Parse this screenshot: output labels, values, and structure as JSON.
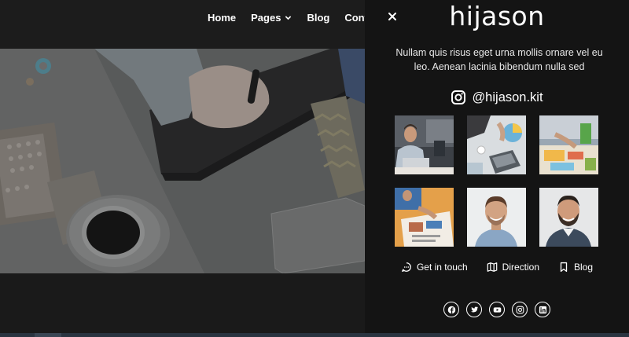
{
  "nav": {
    "items": [
      {
        "label": "Home"
      },
      {
        "label": "Pages",
        "has_dropdown": true
      },
      {
        "label": "Blog"
      },
      {
        "label": "Contact U"
      }
    ]
  },
  "panel": {
    "logo": "hijason",
    "description": "Nullam quis risus eget urna mollis ornare vel eu leo. Aenean lacinia bibendum nulla sed",
    "instagram_handle": "@hijason.kit",
    "gallery": [
      {
        "icon": "photo-man-laptop"
      },
      {
        "icon": "photo-desk-laptop"
      },
      {
        "icon": "photo-charts-table"
      },
      {
        "icon": "photo-magazine-reader"
      },
      {
        "icon": "photo-portrait-man"
      },
      {
        "icon": "photo-portrait-man-beard"
      }
    ],
    "links": [
      {
        "label": "Get in touch",
        "icon": "chat-icon"
      },
      {
        "label": "Direction",
        "icon": "map-icon"
      },
      {
        "label": "Blog",
        "icon": "bookmark-icon"
      }
    ],
    "social": [
      {
        "icon": "facebook-icon"
      },
      {
        "icon": "twitter-icon"
      },
      {
        "icon": "youtube-icon"
      },
      {
        "icon": "instagram-icon"
      },
      {
        "icon": "linkedin-icon"
      }
    ]
  },
  "colors": {
    "panel_bg": "#141414",
    "page_bg": "#1c1c1c",
    "text": "#ffffff"
  }
}
